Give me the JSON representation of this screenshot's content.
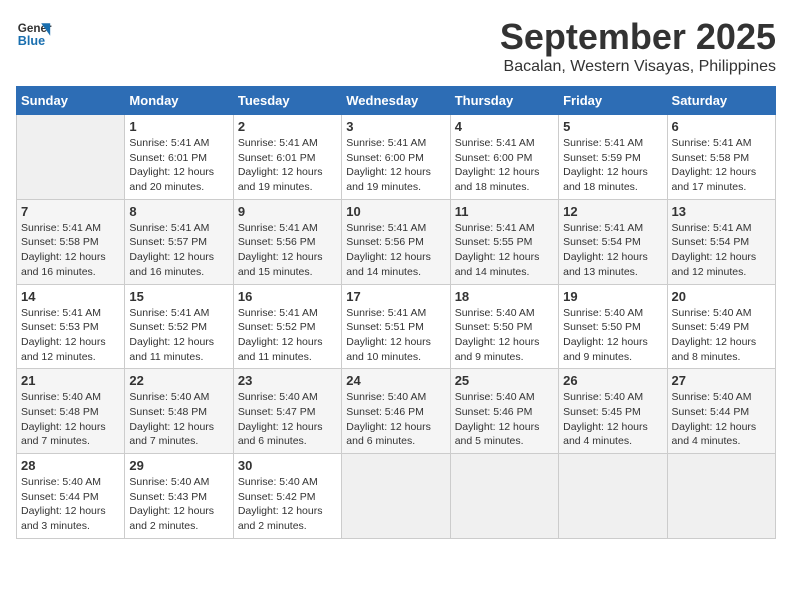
{
  "header": {
    "logo_line1": "General",
    "logo_line2": "Blue",
    "title": "September 2025",
    "subtitle": "Bacalan, Western Visayas, Philippines"
  },
  "days_of_week": [
    "Sunday",
    "Monday",
    "Tuesday",
    "Wednesday",
    "Thursday",
    "Friday",
    "Saturday"
  ],
  "weeks": [
    [
      {
        "day": "",
        "detail": ""
      },
      {
        "day": "1",
        "detail": "Sunrise: 5:41 AM\nSunset: 6:01 PM\nDaylight: 12 hours\nand 20 minutes."
      },
      {
        "day": "2",
        "detail": "Sunrise: 5:41 AM\nSunset: 6:01 PM\nDaylight: 12 hours\nand 19 minutes."
      },
      {
        "day": "3",
        "detail": "Sunrise: 5:41 AM\nSunset: 6:00 PM\nDaylight: 12 hours\nand 19 minutes."
      },
      {
        "day": "4",
        "detail": "Sunrise: 5:41 AM\nSunset: 6:00 PM\nDaylight: 12 hours\nand 18 minutes."
      },
      {
        "day": "5",
        "detail": "Sunrise: 5:41 AM\nSunset: 5:59 PM\nDaylight: 12 hours\nand 18 minutes."
      },
      {
        "day": "6",
        "detail": "Sunrise: 5:41 AM\nSunset: 5:58 PM\nDaylight: 12 hours\nand 17 minutes."
      }
    ],
    [
      {
        "day": "7",
        "detail": "Sunrise: 5:41 AM\nSunset: 5:58 PM\nDaylight: 12 hours\nand 16 minutes."
      },
      {
        "day": "8",
        "detail": "Sunrise: 5:41 AM\nSunset: 5:57 PM\nDaylight: 12 hours\nand 16 minutes."
      },
      {
        "day": "9",
        "detail": "Sunrise: 5:41 AM\nSunset: 5:56 PM\nDaylight: 12 hours\nand 15 minutes."
      },
      {
        "day": "10",
        "detail": "Sunrise: 5:41 AM\nSunset: 5:56 PM\nDaylight: 12 hours\nand 14 minutes."
      },
      {
        "day": "11",
        "detail": "Sunrise: 5:41 AM\nSunset: 5:55 PM\nDaylight: 12 hours\nand 14 minutes."
      },
      {
        "day": "12",
        "detail": "Sunrise: 5:41 AM\nSunset: 5:54 PM\nDaylight: 12 hours\nand 13 minutes."
      },
      {
        "day": "13",
        "detail": "Sunrise: 5:41 AM\nSunset: 5:54 PM\nDaylight: 12 hours\nand 12 minutes."
      }
    ],
    [
      {
        "day": "14",
        "detail": "Sunrise: 5:41 AM\nSunset: 5:53 PM\nDaylight: 12 hours\nand 12 minutes."
      },
      {
        "day": "15",
        "detail": "Sunrise: 5:41 AM\nSunset: 5:52 PM\nDaylight: 12 hours\nand 11 minutes."
      },
      {
        "day": "16",
        "detail": "Sunrise: 5:41 AM\nSunset: 5:52 PM\nDaylight: 12 hours\nand 11 minutes."
      },
      {
        "day": "17",
        "detail": "Sunrise: 5:41 AM\nSunset: 5:51 PM\nDaylight: 12 hours\nand 10 minutes."
      },
      {
        "day": "18",
        "detail": "Sunrise: 5:40 AM\nSunset: 5:50 PM\nDaylight: 12 hours\nand 9 minutes."
      },
      {
        "day": "19",
        "detail": "Sunrise: 5:40 AM\nSunset: 5:50 PM\nDaylight: 12 hours\nand 9 minutes."
      },
      {
        "day": "20",
        "detail": "Sunrise: 5:40 AM\nSunset: 5:49 PM\nDaylight: 12 hours\nand 8 minutes."
      }
    ],
    [
      {
        "day": "21",
        "detail": "Sunrise: 5:40 AM\nSunset: 5:48 PM\nDaylight: 12 hours\nand 7 minutes."
      },
      {
        "day": "22",
        "detail": "Sunrise: 5:40 AM\nSunset: 5:48 PM\nDaylight: 12 hours\nand 7 minutes."
      },
      {
        "day": "23",
        "detail": "Sunrise: 5:40 AM\nSunset: 5:47 PM\nDaylight: 12 hours\nand 6 minutes."
      },
      {
        "day": "24",
        "detail": "Sunrise: 5:40 AM\nSunset: 5:46 PM\nDaylight: 12 hours\nand 6 minutes."
      },
      {
        "day": "25",
        "detail": "Sunrise: 5:40 AM\nSunset: 5:46 PM\nDaylight: 12 hours\nand 5 minutes."
      },
      {
        "day": "26",
        "detail": "Sunrise: 5:40 AM\nSunset: 5:45 PM\nDaylight: 12 hours\nand 4 minutes."
      },
      {
        "day": "27",
        "detail": "Sunrise: 5:40 AM\nSunset: 5:44 PM\nDaylight: 12 hours\nand 4 minutes."
      }
    ],
    [
      {
        "day": "28",
        "detail": "Sunrise: 5:40 AM\nSunset: 5:44 PM\nDaylight: 12 hours\nand 3 minutes."
      },
      {
        "day": "29",
        "detail": "Sunrise: 5:40 AM\nSunset: 5:43 PM\nDaylight: 12 hours\nand 2 minutes."
      },
      {
        "day": "30",
        "detail": "Sunrise: 5:40 AM\nSunset: 5:42 PM\nDaylight: 12 hours\nand 2 minutes."
      },
      {
        "day": "",
        "detail": ""
      },
      {
        "day": "",
        "detail": ""
      },
      {
        "day": "",
        "detail": ""
      },
      {
        "day": "",
        "detail": ""
      }
    ]
  ]
}
